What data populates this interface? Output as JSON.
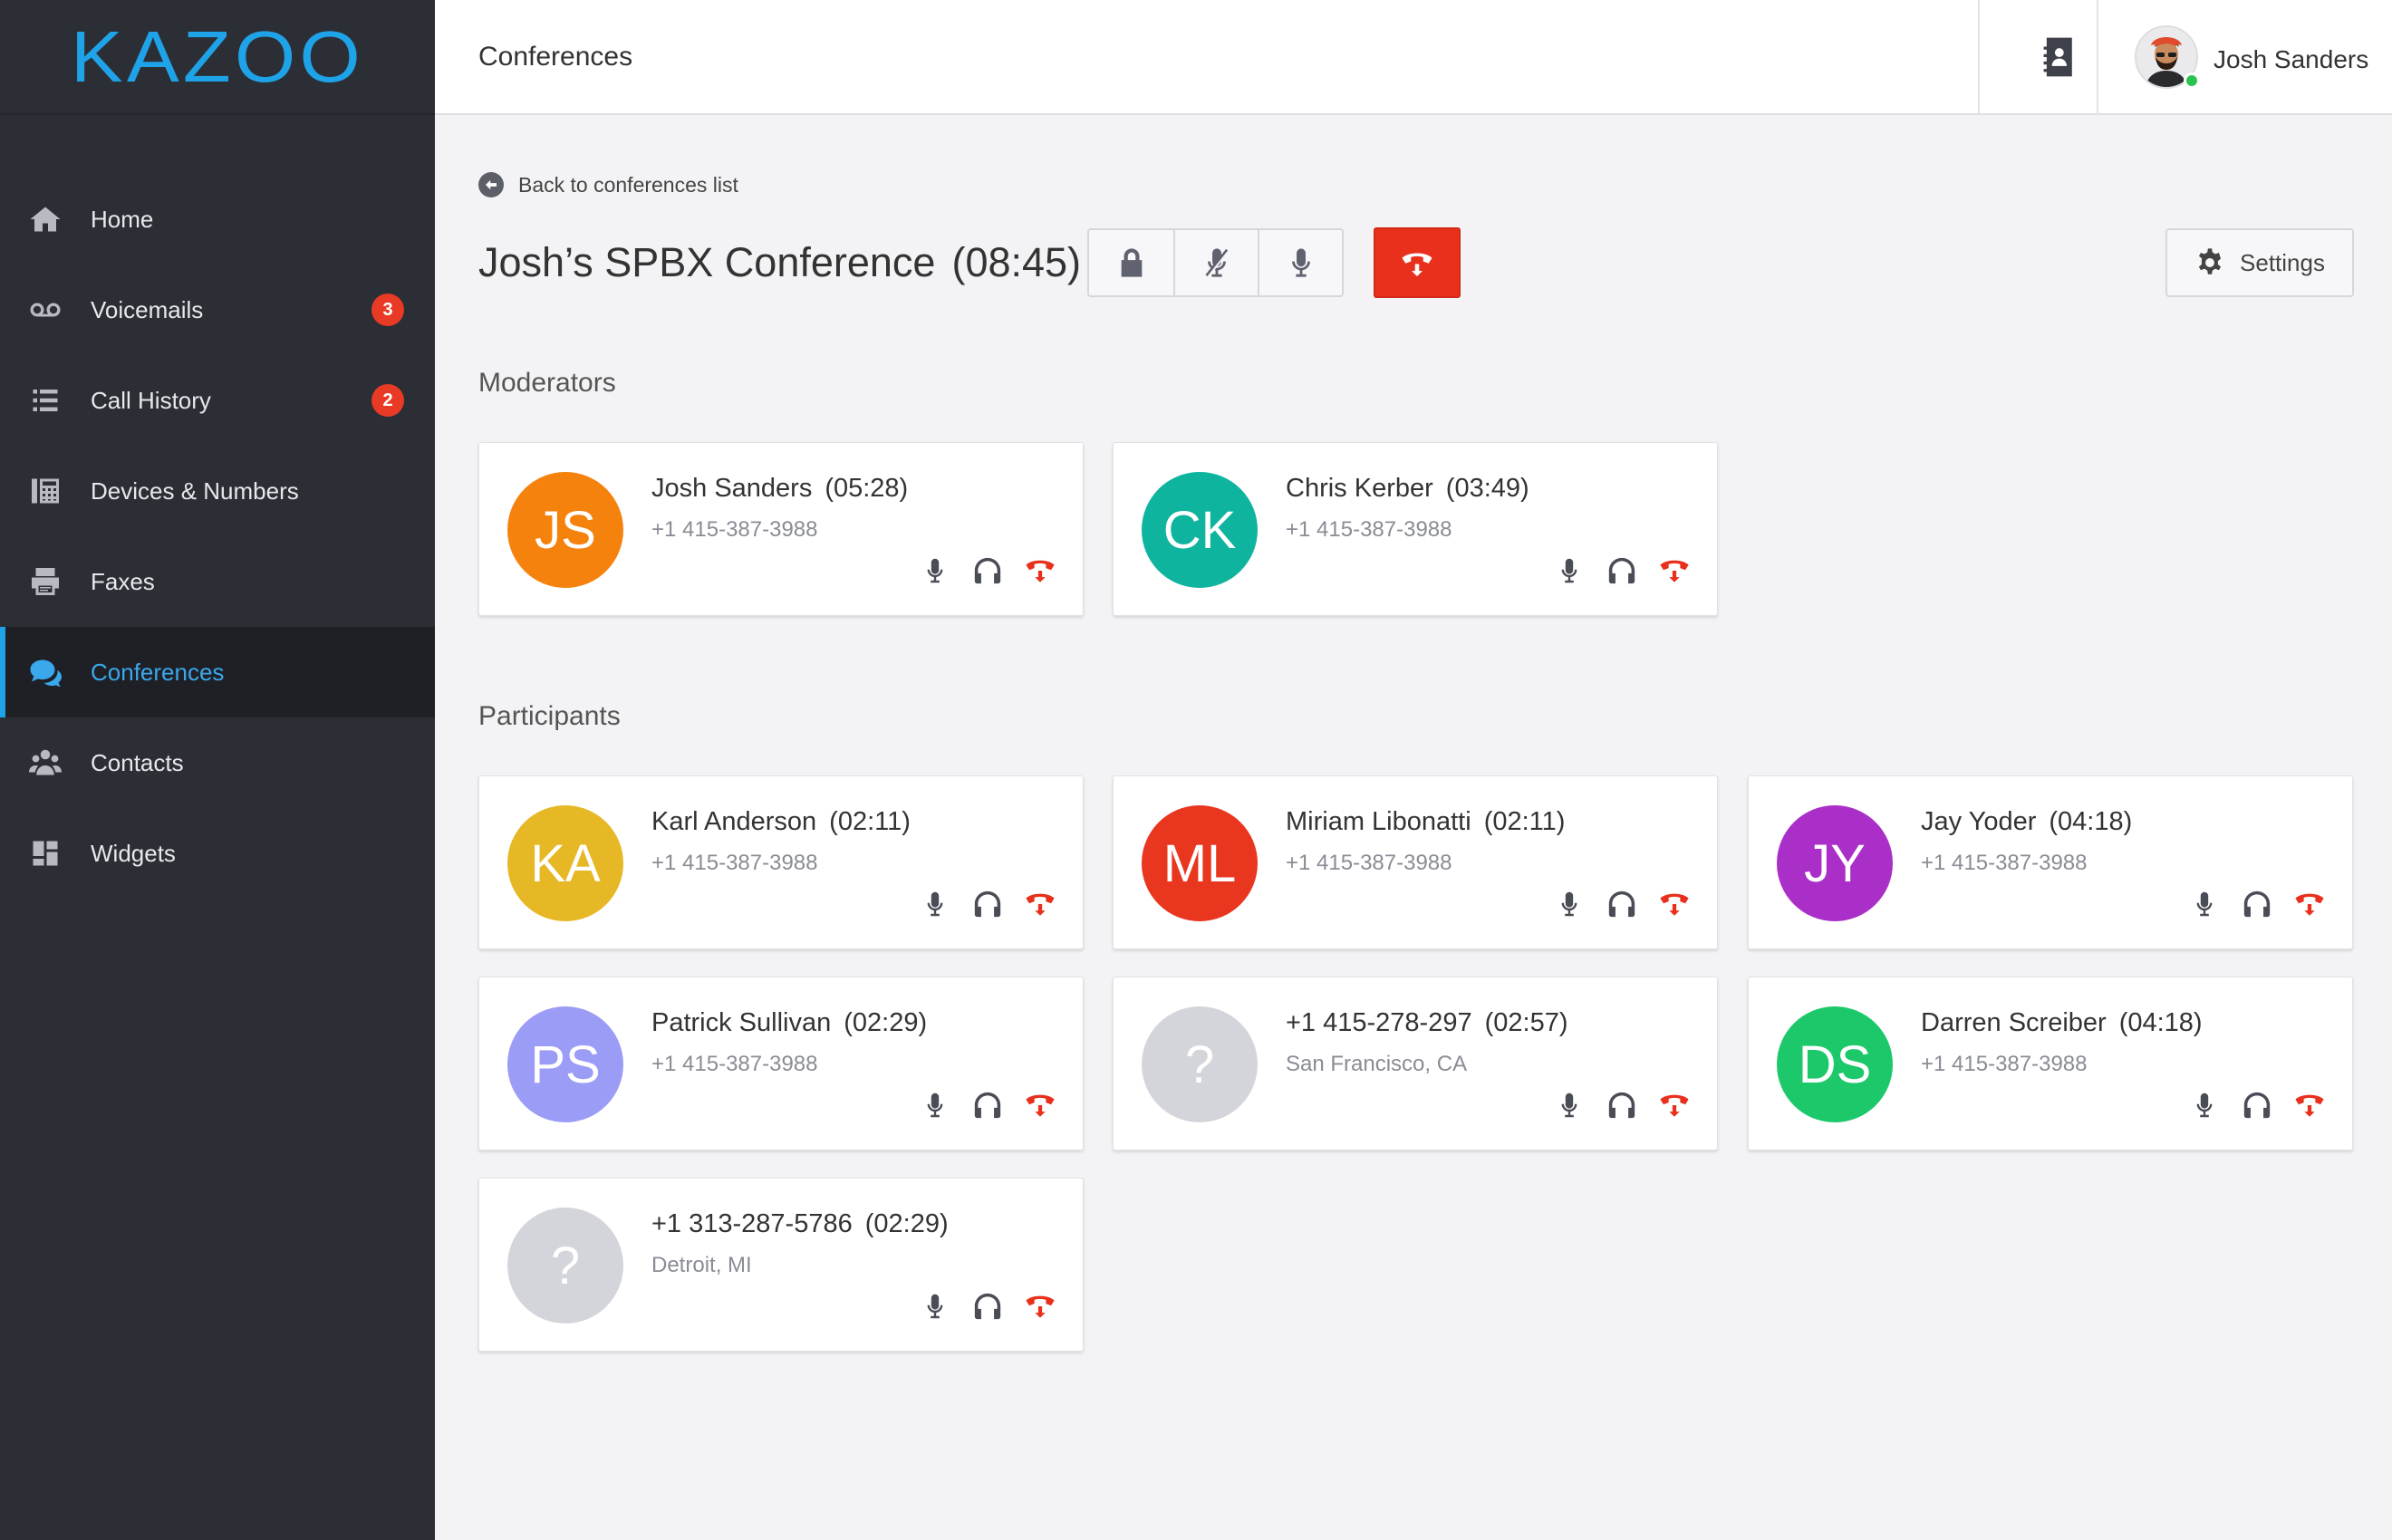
{
  "app": {
    "logo": "KAZOO"
  },
  "sidebar": {
    "items": [
      {
        "label": "Home",
        "icon": "home-icon",
        "badge": ""
      },
      {
        "label": "Voicemails",
        "icon": "voicemail-icon",
        "badge": "3"
      },
      {
        "label": "Call History",
        "icon": "list-icon",
        "badge": "2"
      },
      {
        "label": "Devices & Numbers",
        "icon": "devices-icon",
        "badge": ""
      },
      {
        "label": "Faxes",
        "icon": "fax-icon",
        "badge": ""
      },
      {
        "label": "Conferences",
        "icon": "chat-bubbles-icon",
        "badge": "",
        "active": true
      },
      {
        "label": "Contacts",
        "icon": "users-icon",
        "badge": ""
      },
      {
        "label": "Widgets",
        "icon": "widgets-icon",
        "badge": ""
      }
    ]
  },
  "header": {
    "title": "Conferences",
    "user_name": "Josh Sanders"
  },
  "main": {
    "back_label": "Back to conferences list",
    "conference_name": "Josh’s SPBX Conference",
    "conference_time": "(08:45)",
    "settings_label": "Settings",
    "moderators_title": "Moderators",
    "participants_title": "Participants"
  },
  "moderators": [
    {
      "initials": "JS",
      "name": "Josh Sanders",
      "time": "(05:28)",
      "sub": "+1 415-387-3988",
      "color": "#f5820d"
    },
    {
      "initials": "CK",
      "name": "Chris Kerber",
      "time": "(03:49)",
      "sub": "+1 415-387-3988",
      "color": "#0fb49f"
    }
  ],
  "participants": [
    {
      "initials": "KA",
      "name": "Karl Anderson",
      "time": "(02:11)",
      "sub": "+1 415-387-3988",
      "color": "#e6b825"
    },
    {
      "initials": "ML",
      "name": "Miriam Libonatti",
      "time": "(02:11)",
      "sub": "+1 415-387-3988",
      "color": "#e8361f"
    },
    {
      "initials": "JY",
      "name": "Jay Yoder",
      "time": "(04:18)",
      "sub": "+1 415-387-3988",
      "color": "#aa2fc8"
    },
    {
      "initials": "PS",
      "name": "Patrick Sullivan",
      "time": "(02:29)",
      "sub": "+1 415-387-3988",
      "color": "#9b9cf5"
    },
    {
      "initials": "?",
      "name": "+1 415-278-297",
      "time": "(02:57)",
      "sub": "San Francisco, CA",
      "color": "#d4d5db"
    },
    {
      "initials": "DS",
      "name": "Darren Screiber",
      "time": "(04:18)",
      "sub": "+1 415-387-3988",
      "color": "#1dc86b"
    },
    {
      "initials": "?",
      "name": "+1 313-287-5786",
      "time": "(02:29)",
      "sub": "Detroit, MI",
      "color": "#d4d5db"
    }
  ],
  "colors": {
    "accent": "#1fa3e8",
    "danger": "#e8301c",
    "sidebar": "#2c2e36"
  }
}
